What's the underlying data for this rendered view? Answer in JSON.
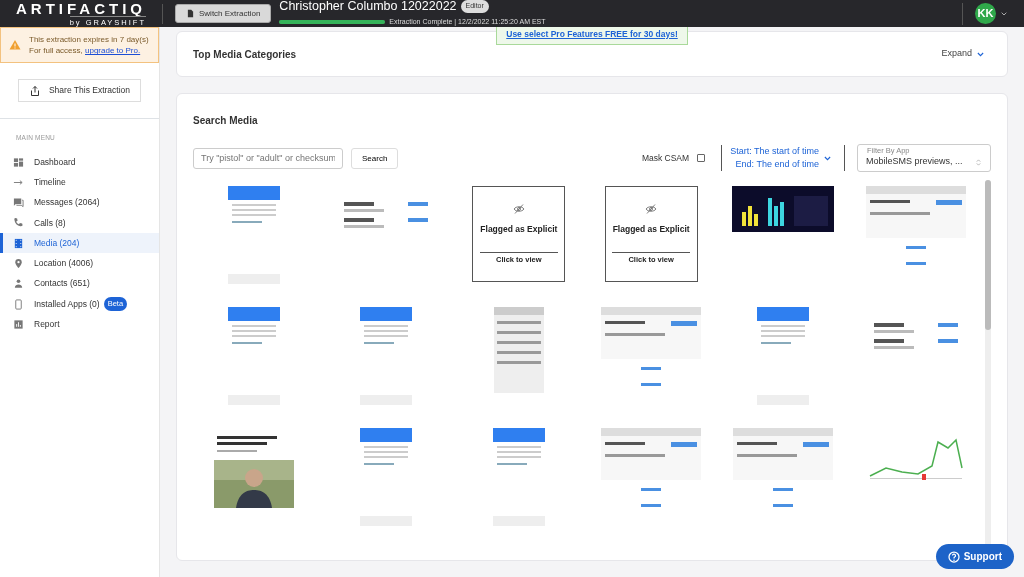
{
  "topbar": {
    "logo": "ARTIFACTIQ",
    "logo_sub": "by GRAYSHIFT",
    "switch_button": "Switch Extraction",
    "title": "Christopher Columbo 12022022",
    "badge": "Editor",
    "progress": {
      "level": 1
    },
    "status": "Extraction Complete | 12/2/2022 11:25:20 AM EST",
    "avatar": "KK",
    "promo": "Use select Pro Features FREE for 30 days!"
  },
  "sidebar": {
    "warning": {
      "line1": "This extraction expires in 7 day(s)",
      "line2": "For full access, ",
      "link": "upgrade to Pro."
    },
    "share_button": "Share This Extraction",
    "menu_title": "MAIN MENU",
    "items": [
      {
        "label": "Dashboard",
        "selected": false
      },
      {
        "label": "Timeline",
        "selected": false
      },
      {
        "label": "Messages (2064)",
        "selected": false
      },
      {
        "label": "Calls (8)",
        "selected": false
      },
      {
        "label": "Media (204)",
        "selected": true
      },
      {
        "label": "Location (4006)",
        "selected": false
      },
      {
        "label": "Contacts (651)",
        "selected": false
      },
      {
        "label": "Installed Apps (0)",
        "selected": false,
        "badge": "Beta"
      },
      {
        "label": "Report",
        "selected": false
      }
    ]
  },
  "categories_card": {
    "title": "Top Media Categories",
    "expand": "Expand"
  },
  "search_card": {
    "title": "Search Media",
    "search_placeholder": "Try \"pistol\" or \"adult\" or checksum",
    "search_button": "Search",
    "mask_label": "Mask CSAM",
    "mask_checked": false,
    "date_start": "Start: The start of time",
    "date_end": "End: The end of time",
    "filter_label": "Filter By App",
    "filter_value": "MobileSMS previews, ...",
    "media": [
      {
        "kind": "picture"
      },
      {
        "kind": "picture"
      },
      {
        "kind": "flagged",
        "title": "Flagged as Explicit",
        "action": "Click to view"
      },
      {
        "kind": "flagged",
        "title": "Flagged as Explicit",
        "action": "Click to view"
      },
      {
        "kind": "picture"
      },
      {
        "kind": "picture"
      },
      {
        "kind": "picture"
      },
      {
        "kind": "picture"
      },
      {
        "kind": "picture"
      },
      {
        "kind": "picture"
      },
      {
        "kind": "picture"
      },
      {
        "kind": "picture"
      },
      {
        "kind": "picture"
      },
      {
        "kind": "picture"
      },
      {
        "kind": "picture"
      },
      {
        "kind": "picture"
      },
      {
        "kind": "picture"
      },
      {
        "kind": "picture"
      }
    ]
  },
  "support_button": "Support"
}
